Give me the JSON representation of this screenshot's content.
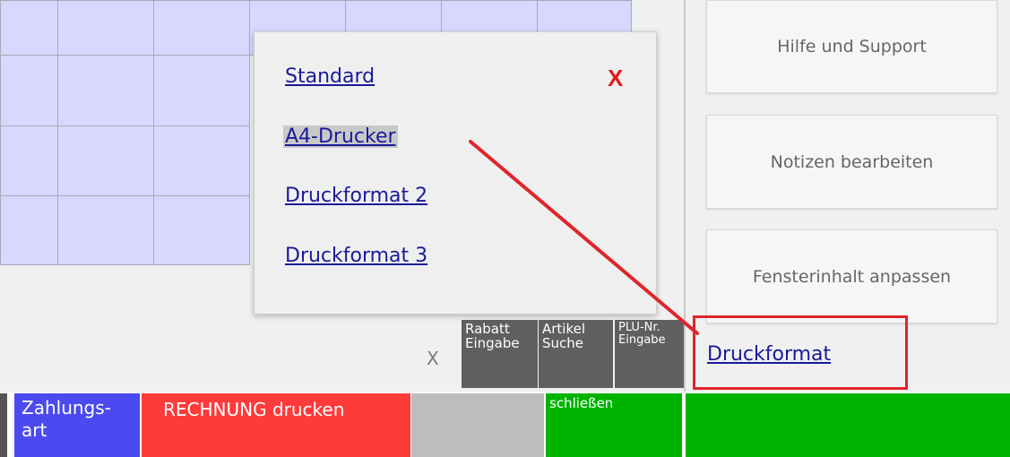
{
  "popup": {
    "close_label": "X",
    "items": [
      {
        "label": "Standard"
      },
      {
        "label": "A4-Drucker"
      },
      {
        "label": "Druckformat 2"
      },
      {
        "label": "Druckformat 3"
      }
    ]
  },
  "sidebar": {
    "help_label": "Hilfe und Support",
    "notes_label": "Notizen bearbeiten",
    "fit_label": "Fensterinhalt anpassen",
    "print_format_label": "Druckformat"
  },
  "toolbar": {
    "clear_label": "X",
    "rabatt_label": "Rabatt Eingabe",
    "artikel_label": "Artikel Suche",
    "plu_label": "PLU-Nr. Eingabe"
  },
  "bottom_bar": {
    "zahlungsart_label": "Zahlungs-art",
    "invoice_label": "RECHNUNG drucken",
    "close_label": "schließen"
  },
  "colors": {
    "grid_cell": "#d8d8ff",
    "link": "#1a1a9a",
    "annotation": "#e0252b",
    "zahlungsart": "#4a4af0",
    "invoice": "#ff3a3a",
    "close": "#00b300",
    "neutral": "#bdbdbd",
    "tool": "#5f5f5f"
  }
}
